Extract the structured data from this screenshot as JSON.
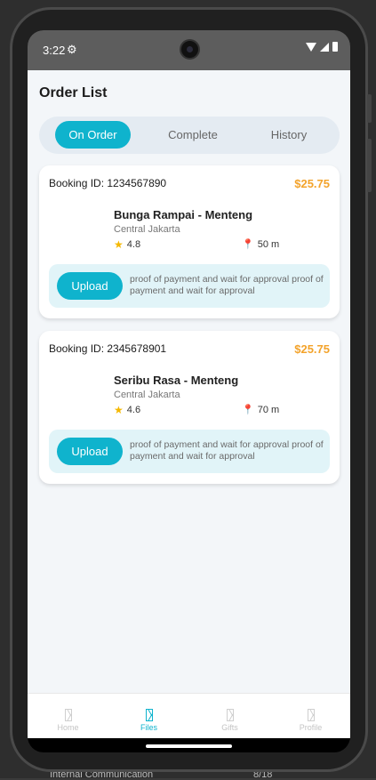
{
  "status_bar": {
    "time": "3:22"
  },
  "page_title": "Order List",
  "tabs": [
    {
      "label": "On Order",
      "active": true
    },
    {
      "label": "Complete",
      "active": false
    },
    {
      "label": "History",
      "active": false
    }
  ],
  "orders": [
    {
      "booking_label": "Booking ID: 1234567890",
      "price": "$25.75",
      "place_name": "Bunga Rampai - Menteng",
      "area": "Central Jakarta",
      "rating": "4.8",
      "distance": "50 m",
      "upload_label": "Upload",
      "upload_text": "proof of payment and wait for approval proof of payment and wait for approval"
    },
    {
      "booking_label": "Booking ID: 2345678901",
      "price": "$25.75",
      "place_name": "Seribu Rasa - Menteng",
      "area": "Central Jakarta",
      "rating": "4.6",
      "distance": "70 m",
      "upload_label": "Upload",
      "upload_text": "proof of payment and wait for approval proof of payment and wait for approval"
    }
  ],
  "bottom_nav": [
    {
      "label": "Home",
      "icon": "hourglass-icon",
      "active": false
    },
    {
      "label": "Files",
      "icon": "hourglass-icon",
      "active": true
    },
    {
      "label": "Gifts",
      "icon": "hourglass-icon",
      "active": false
    },
    {
      "label": "Profile",
      "icon": "hourglass-icon",
      "active": false
    }
  ],
  "background_partial_text": "Internal Communication",
  "background_partial_number": "8/18",
  "colors": {
    "accent": "#0fb3cd",
    "price": "#f3a32b",
    "upload_box": "#e1f4f8",
    "page_bg": "#f3f6f9"
  }
}
